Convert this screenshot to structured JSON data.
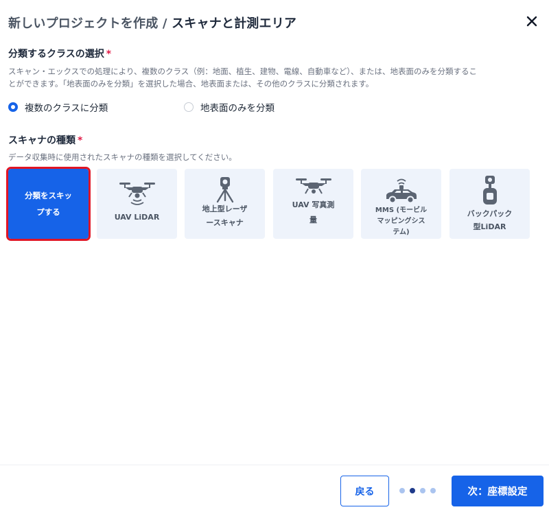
{
  "dialog": {
    "title_prefix": "新しいプロジェクトを作成 / ",
    "title_main": "スキャナと計測エリア",
    "close_icon": "close-icon"
  },
  "classification": {
    "label": "分類するクラスの選択",
    "required_mark": "*",
    "description_line1": "スキャン・エックスでの処理により、複数のクラス（例：地面、植生、建物、電線、自動車など）、または、地表面のみを分類するこ",
    "description_line2": "とができます。「地表面のみを分類」を選択した場合、地表面または、その他のクラスに分類されます。",
    "options": [
      {
        "label": "複数のクラスに分類",
        "selected": true
      },
      {
        "label": "地表面のみを分類",
        "selected": false
      }
    ]
  },
  "scanner": {
    "label": "スキャナの種類",
    "required_mark": "*",
    "description": "データ収集時に使用されたスキャナの種類を選択してください。",
    "types": [
      {
        "line1": "分類をスキッ",
        "line2": "プする",
        "icon": "none",
        "selected": true
      },
      {
        "line1": "UAV LiDAR",
        "line2": "",
        "icon": "drone-lidar-icon",
        "selected": false
      },
      {
        "line1": "地上型レーザ",
        "line2": "ースキャナ",
        "icon": "tripod-scanner-icon",
        "selected": false
      },
      {
        "line1": "UAV 写真測",
        "line2": "量",
        "icon": "drone-icon",
        "selected": false
      },
      {
        "line1": "MMS (モービル",
        "line2": "マッピングシス",
        "line3": "テム)",
        "icon": "car-scanner-icon",
        "selected": false
      },
      {
        "line1": "バックパック",
        "line2": "型LiDAR",
        "icon": "backpack-scanner-icon",
        "selected": false
      }
    ]
  },
  "footer": {
    "back_label": "戻る",
    "next_label": "次：座標設定",
    "steps_total": 4,
    "step_current": 2
  },
  "colors": {
    "accent": "#1663e8",
    "required": "#e11d48",
    "selection_outline": "#e11524",
    "card_bg": "#eef3fb",
    "icon": "#5b6472"
  }
}
